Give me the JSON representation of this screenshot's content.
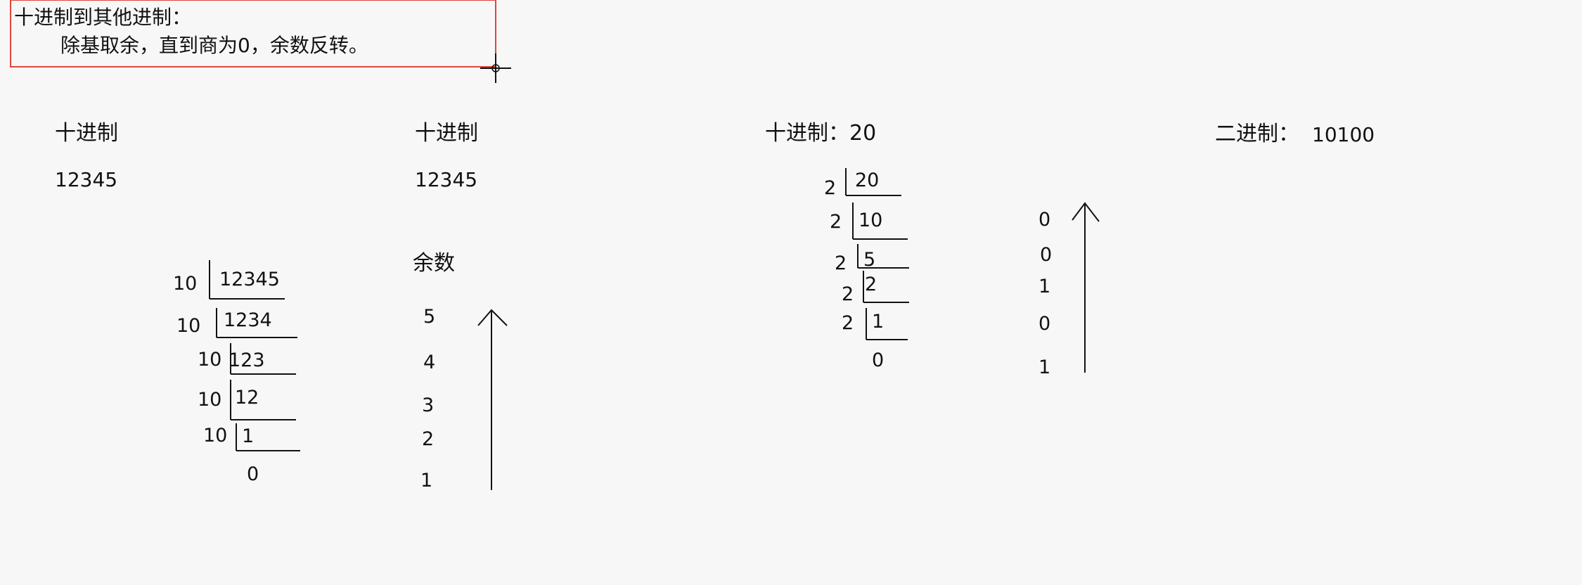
{
  "note": {
    "title": "十进制到其他进制：",
    "rule": "除基取余，直到商为0，余数反转。",
    "border_color": "#e0463c"
  },
  "decimal_example": {
    "left_label": "十进制",
    "left_value": "12345",
    "right_label": "十进制",
    "right_value": "12345",
    "remainder_label": "余数",
    "divisor": "10",
    "dividends": [
      "12345",
      "1234",
      "123",
      "12",
      "1"
    ],
    "final_quotient": "0",
    "remainders_top_to_bottom": [
      "5",
      "4",
      "3",
      "2",
      "1"
    ]
  },
  "binary_example": {
    "decimal_label": "十进制：20",
    "binary_label": "二进制：",
    "binary_value": "10100",
    "divisor": "2",
    "dividends": [
      "20",
      "10",
      "5",
      "2",
      "1"
    ],
    "final_quotient": "0",
    "remainders_top_to_bottom": [
      "0",
      "0",
      "1",
      "0",
      "1"
    ]
  },
  "icons": {
    "cursor": "crosshair-cursor-icon",
    "arrow": "arrow-up-icon"
  }
}
